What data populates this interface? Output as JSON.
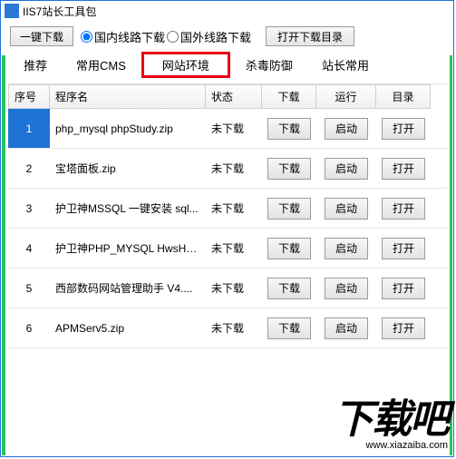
{
  "title": "IIS7站长工具包",
  "toolbar": {
    "download_all": "一键下载",
    "radio_domestic": "国内线路下载",
    "radio_overseas": "国外线路下载",
    "open_dir": "打开下载目录"
  },
  "tabs": [
    "推荐",
    "常用CMS",
    "网站环境",
    "杀毒防御",
    "站长常用"
  ],
  "columns": {
    "seq": "序号",
    "name": "程序名",
    "status": "状态",
    "download": "下载",
    "run": "运行",
    "dir": "目录"
  },
  "buttons": {
    "download": "下载",
    "run": "启动",
    "open": "打开"
  },
  "status_text": "未下载",
  "rows": [
    {
      "seq": "1",
      "name": "php_mysql phpStudy.zip"
    },
    {
      "seq": "2",
      "name": "宝塔面板.zip"
    },
    {
      "seq": "3",
      "name": "护卫神MSSQL 一键安装 sql..."
    },
    {
      "seq": "4",
      "name": "护卫神PHP_MYSQL HwsHostM..."
    },
    {
      "seq": "5",
      "name": "西部数码网站管理助手 V4...."
    },
    {
      "seq": "6",
      "name": "APMServ5.zip"
    }
  ],
  "watermark": {
    "text": "下载吧",
    "url": "www.xiazaiba.com"
  }
}
